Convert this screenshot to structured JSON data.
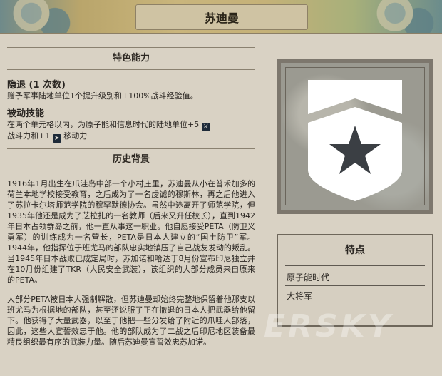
{
  "header": {
    "title": "苏迪曼"
  },
  "left": {
    "abilities_heading": "特色能力",
    "ability": {
      "title": "隐退 (1 次数)",
      "desc": "赠予军事陆地单位1个提升级别和+100%战斗经验值。"
    },
    "passive": {
      "title": "被动技能",
      "line1": "在两个单元格以内，为原子能和信息时代的陆地单位+5",
      "line2a": "战斗力和+1",
      "line2b": "移动力",
      "icon_strength": "sword-icon",
      "icon_movement": "movement-arrow-icon"
    },
    "history_heading": "历史背景",
    "history_p1": "1916年1月出生在爪洼岛中部一个小村庄里，苏迪曼从小在普禾加多的荷兰本地学校接受教育，之后成为了一名虔诚的穆斯林，再之后他进入了苏拉卡尔塔师范学院的穆罕默德协会。虽然中途离开了师范学院，但1935年他还是成为了芝拉扎的一名教师（后来又升任校长），直到1942年日本占领群岛之前，他一直从事这一职业。他自愿接受PETA（防卫义勇军）的训练成为一名营长，PETA是日本人建立的“国土防卫”军。1944年，他指挥位于班尤马的部队忠实地镇压了自己战友发动的叛乱。当1945年日本战败已成定局时，苏加诺和哈达于8月份宣布印尼独立并在10月份组建了TKR（人民安全武装），该组织的大部分成员来自原来的PETA。",
    "history_p2": "大部分PETA被日本人强制解散，但苏迪曼却始终完整地保留着他那支以班尤马为根据地的部队，甚至还说服了正在撤退的日本人把武器给他留下。他获得了大量武器，以至于他把一些分发给了附近的爪哇人部落，因此，这些人宣誓效忠于他。他的部队成为了二战之后印尼地区装备最精良组织最有序的武装力量。随后苏迪曼宣誓效忠苏加诺。"
  },
  "right": {
    "emblem_icon": "shield-star-icon",
    "traits_heading": "特点",
    "traits": [
      "原子能时代",
      "大将军"
    ]
  },
  "watermark": "ERSKY"
}
